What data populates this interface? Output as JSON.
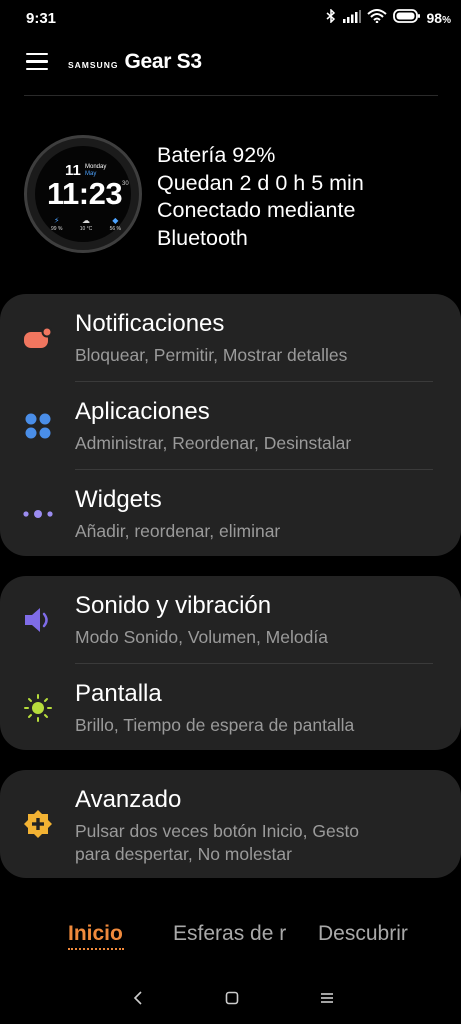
{
  "status_bar": {
    "time": "9:31",
    "battery_level": "98",
    "battery_suffix": "%"
  },
  "header": {
    "brand_samsung": "SAMSUNG",
    "brand_product": "Gear S3"
  },
  "watch_face": {
    "day_num": "11",
    "weekday": "Monday",
    "month": "May",
    "time": "11:23",
    "seconds": "30",
    "stat1": "99 %",
    "stat2": "10 °C",
    "stat3": "56 %"
  },
  "device_info": {
    "battery": "Batería 92%",
    "remaining": "Quedan 2 d 0 h 5 min",
    "connected": "Conectado mediante",
    "via": "Bluetooth"
  },
  "menu": {
    "notifications": {
      "title": "Notificaciones",
      "subtitle": "Bloquear, Permitir, Mostrar detalles"
    },
    "apps": {
      "title": "Aplicaciones",
      "subtitle": "Administrar, Reordenar, Desinstalar"
    },
    "widgets": {
      "title": "Widgets",
      "subtitle": "Añadir, reordenar, eliminar"
    },
    "sound": {
      "title": "Sonido y vibración",
      "subtitle": "Modo Sonido, Volumen, Melodía"
    },
    "display": {
      "title": "Pantalla",
      "subtitle": "Brillo, Tiempo de espera de pantalla"
    },
    "advanced": {
      "title": "Avanzado",
      "subtitle_line1": "Pulsar dos veces botón Inicio, Gesto",
      "subtitle_line2": "para despertar, No molestar"
    }
  },
  "tabs": {
    "home": "Inicio",
    "faces": "Esferas de r",
    "discover": "Descubrir"
  },
  "colors": {
    "accent": "#f08a3c",
    "card_bg": "#232323",
    "notif_icon": "#f0765f",
    "apps_icon": "#4a8ee8",
    "widgets_icon": "#9b8cf0",
    "sound_icon": "#7f6ce8",
    "display_icon": "#b7dd3c",
    "advanced_icon": "#f2b233"
  }
}
